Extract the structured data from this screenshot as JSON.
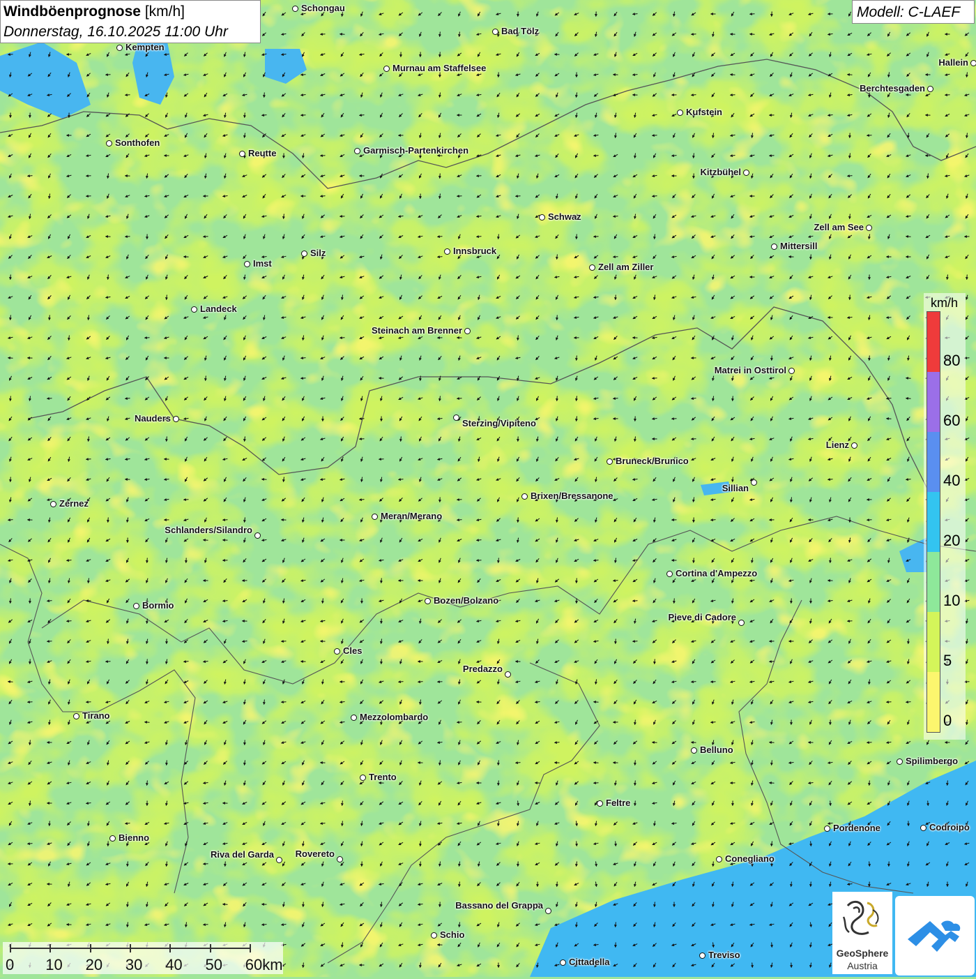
{
  "header": {
    "title": "Windböenprognose",
    "unit": "[km/h]",
    "datetime": "Donnerstag, 16.10.2025 11:00 Uhr"
  },
  "model": {
    "label": "Modell: C-LAEF"
  },
  "legend": {
    "unit": "km/h",
    "ticks": [
      "80",
      "60",
      "40",
      "20",
      "10",
      "5",
      "0"
    ],
    "colors": [
      "#ef3b3b",
      "#9b6fe8",
      "#5a8ff0",
      "#33c4f0",
      "#8ee89a",
      "#d4f55a",
      "#fcf66e"
    ]
  },
  "scale_bar": {
    "labels": [
      "0",
      "10",
      "20",
      "30",
      "40",
      "50",
      "60km"
    ]
  },
  "logos": {
    "geosphere_name": "GeoSphere",
    "geosphere_sub": "Austria"
  },
  "map_colors": {
    "calm": "#fcf66e",
    "low": "#d4f55a",
    "moderate": "#8ee89a",
    "strong": "#33c4f0",
    "water": "#40b0f0",
    "border": "#555555"
  },
  "cities": [
    {
      "name": "Schongau"
    },
    {
      "name": "Kempten"
    },
    {
      "name": "Bad Tölz"
    },
    {
      "name": "Murnau am Staffelsee"
    },
    {
      "name": "Hallein"
    },
    {
      "name": "Berchtesgaden"
    },
    {
      "name": "Kufstein"
    },
    {
      "name": "Sonthofen"
    },
    {
      "name": "Reutte"
    },
    {
      "name": "Garmisch-Partenkirchen"
    },
    {
      "name": "Kitzbühel"
    },
    {
      "name": "Schwaz"
    },
    {
      "name": "Zell am See"
    },
    {
      "name": "Mittersill"
    },
    {
      "name": "Innsbruck"
    },
    {
      "name": "Silz"
    },
    {
      "name": "Imst"
    },
    {
      "name": "Zell am Ziller"
    },
    {
      "name": "Landeck"
    },
    {
      "name": "Steinach am Brenner"
    },
    {
      "name": "Matrei in Osttirol"
    },
    {
      "name": "Nauders"
    },
    {
      "name": "Sterzing/Vipiteno"
    },
    {
      "name": "Lienz"
    },
    {
      "name": "Bruneck/Brunico"
    },
    {
      "name": "Sillian"
    },
    {
      "name": "Zernez"
    },
    {
      "name": "Brixen/Bressanone"
    },
    {
      "name": "Meran/Merano"
    },
    {
      "name": "Schlanders/Silandro"
    },
    {
      "name": "Cortina d'Ampezzo"
    },
    {
      "name": "Bozen/Bolzano"
    },
    {
      "name": "Bormio"
    },
    {
      "name": "Pieve di Cadore"
    },
    {
      "name": "Cles"
    },
    {
      "name": "Predazzo"
    },
    {
      "name": "Tirano"
    },
    {
      "name": "Mezzolombardo"
    },
    {
      "name": "Belluno"
    },
    {
      "name": "Spilimbergo"
    },
    {
      "name": "Trento"
    },
    {
      "name": "Feltre"
    },
    {
      "name": "Pordenone"
    },
    {
      "name": "Codroipo"
    },
    {
      "name": "Bienno"
    },
    {
      "name": "Riva del Garda"
    },
    {
      "name": "Rovereto"
    },
    {
      "name": "Conegliano"
    },
    {
      "name": "Bassano del Grappa"
    },
    {
      "name": "Schio"
    },
    {
      "name": "Treviso"
    },
    {
      "name": "Cittadella"
    }
  ]
}
